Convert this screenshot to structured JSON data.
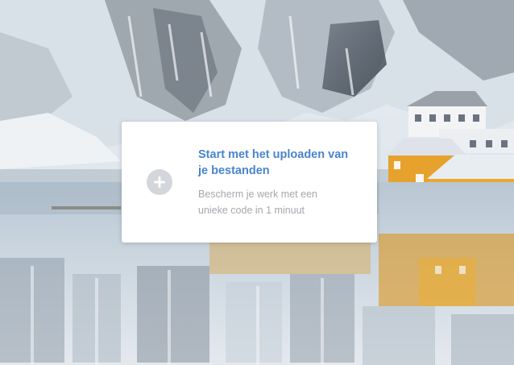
{
  "upload_card": {
    "title": "Start met het uploaden van je bestanden",
    "subtitle": "Bescherm je werk met een unieke code in 1 minuut",
    "add_icon": "plus-icon"
  },
  "colors": {
    "title": "#4a84cf",
    "subtitle": "#a4a8ad",
    "add_button": "#d3d6da",
    "card": "#ffffff"
  },
  "background": {
    "description_icon": "landscape-photo"
  }
}
